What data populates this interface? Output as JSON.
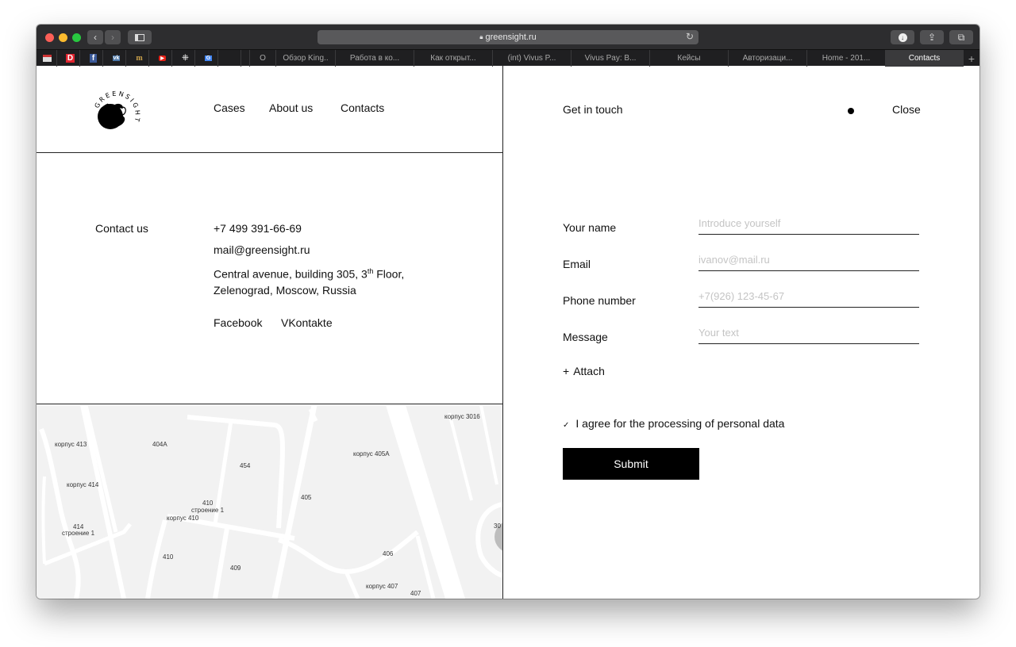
{
  "browser": {
    "url": "greensight.ru",
    "bookmarks": [
      "calendar-favicon",
      "d-favicon",
      "facebook-favicon",
      "vk-favicon",
      "m-favicon",
      "youtube-favicon",
      "pattern-favicon",
      "translate-favicon"
    ],
    "tabs": [
      {
        "label": "О",
        "active": false
      },
      {
        "label": "Обзор King..",
        "active": false
      },
      {
        "label": "Работа в ко...",
        "active": false
      },
      {
        "label": "Как открыт...",
        "active": false
      },
      {
        "label": "(int) Vivus P...",
        "active": false
      },
      {
        "label": "Vivus Pay: B...",
        "active": false
      },
      {
        "label": "Кейсы",
        "active": false
      },
      {
        "label": "Авторизаци...",
        "active": false
      },
      {
        "label": "Home - 201...",
        "active": false
      },
      {
        "label": "Contacts",
        "active": true
      }
    ],
    "new_tab": "+"
  },
  "header": {
    "logo_text": "GREENSIGHT",
    "nav": [
      "Cases",
      "About us",
      "Contacts"
    ]
  },
  "contact": {
    "heading": "Contact us",
    "phone": "+7 499 391-66-69",
    "email": "mail@greensight.ru",
    "address_line1_pre": "Central avenue, building 305, 3",
    "address_sup": "th",
    "address_line1_post": " Floor,",
    "address_line2": "Zelenograd, Moscow, Russia",
    "social": [
      "Facebook",
      "VKontakte"
    ]
  },
  "map": {
    "labels": [
      "корпус 3016",
      "корпус 413",
      "404А",
      "корпус 405А",
      "454",
      "корпус 414",
      "405",
      "410",
      "строение 1",
      "корпус 410",
      "414",
      "строение 1",
      "30",
      "410",
      "406",
      "409",
      "корпус 407",
      "407"
    ]
  },
  "form": {
    "title": "Get in touch",
    "close": "Close",
    "fields": [
      {
        "label": "Your name",
        "placeholder": "Introduce yourself"
      },
      {
        "label": "Email",
        "placeholder": "ivanov@mail.ru"
      },
      {
        "label": "Phone number",
        "placeholder": "+7(926) 123-45-67"
      },
      {
        "label": "Message",
        "placeholder": "Your text"
      }
    ],
    "attach": "Attach",
    "agree": "I agree for the processing of personal data",
    "agree_checked": true,
    "submit": "Submit"
  }
}
